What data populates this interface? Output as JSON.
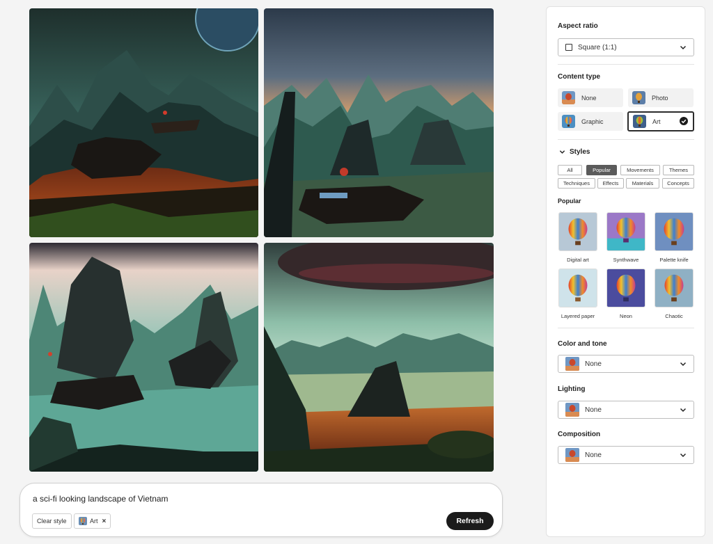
{
  "gallery": {
    "images": [
      {
        "alt": "Sci-fi Vietnam landscape 1"
      },
      {
        "alt": "Sci-fi Vietnam landscape 2"
      },
      {
        "alt": "Sci-fi Vietnam landscape 3"
      },
      {
        "alt": "Sci-fi Vietnam landscape 4"
      }
    ]
  },
  "prompt": {
    "text": "a sci-fi looking landscape of Vietnam",
    "clear_style_label": "Clear style",
    "art_chip_label": "Art",
    "remove_glyph": "×",
    "refresh_label": "Refresh"
  },
  "panel": {
    "aspect_ratio": {
      "title": "Aspect ratio",
      "value": "Square (1:1)"
    },
    "content_type": {
      "title": "Content type",
      "options": [
        {
          "label": "None",
          "selected": false,
          "icon": "balloon-none-thumb"
        },
        {
          "label": "Photo",
          "selected": false,
          "icon": "balloon-photo-thumb"
        },
        {
          "label": "Graphic",
          "selected": false,
          "icon": "balloon-graphic-thumb"
        },
        {
          "label": "Art",
          "selected": true,
          "icon": "balloon-art-thumb"
        }
      ]
    },
    "styles": {
      "title": "Styles",
      "tags": [
        {
          "label": "All",
          "active": false
        },
        {
          "label": "Popular",
          "active": true
        },
        {
          "label": "Movements",
          "active": false
        },
        {
          "label": "Themes",
          "active": false
        },
        {
          "label": "Techniques",
          "active": false
        },
        {
          "label": "Effects",
          "active": false
        },
        {
          "label": "Materials",
          "active": false
        },
        {
          "label": "Concepts",
          "active": false
        }
      ],
      "section_label": "Popular",
      "items": [
        {
          "label": "Digital art",
          "bg": "#b7c8d6"
        },
        {
          "label": "Synthwave",
          "bg": "#9b78c7"
        },
        {
          "label": "Palette knife",
          "bg": "#6f8fc0"
        },
        {
          "label": "Layered paper",
          "bg": "#cfe3ea"
        },
        {
          "label": "Neon",
          "bg": "#4b4c9e"
        },
        {
          "label": "Chaotic",
          "bg": "#8fb0c4"
        }
      ]
    },
    "color_and_tone": {
      "title": "Color and tone",
      "value": "None"
    },
    "lighting": {
      "title": "Lighting",
      "value": "None"
    },
    "composition": {
      "title": "Composition",
      "value": "None"
    }
  },
  "colors": {
    "accent_dark": "#1b1b1b",
    "tag_active": "#5b5b5b",
    "panel_bg": "#ffffff",
    "page_bg": "#f4f4f4"
  }
}
